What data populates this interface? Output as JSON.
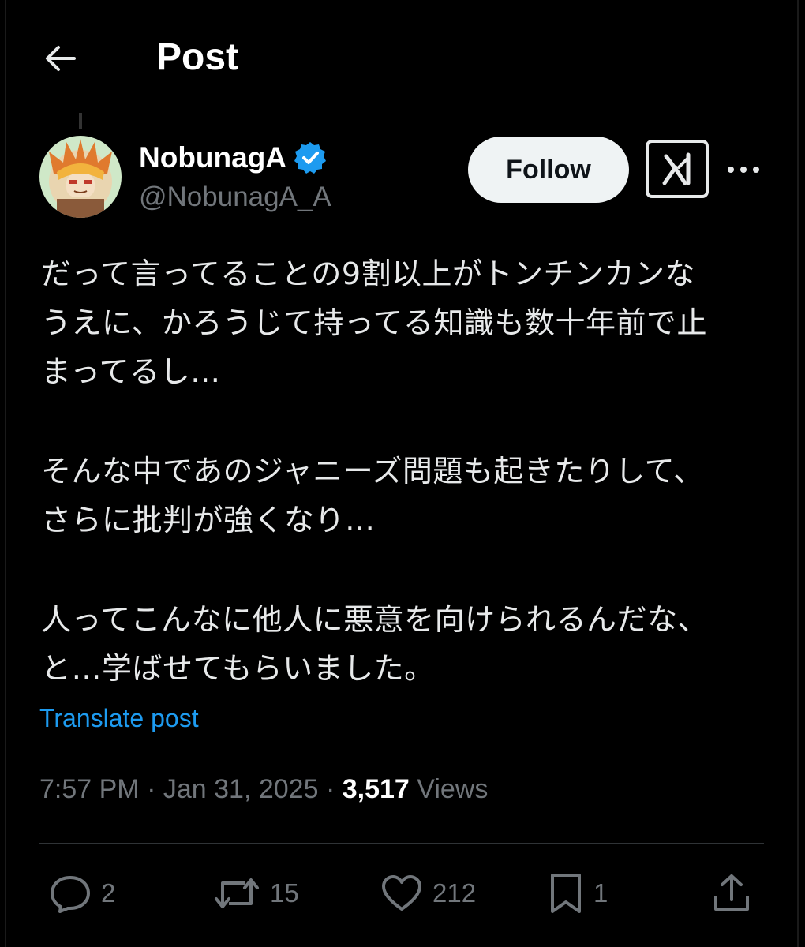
{
  "header": {
    "title": "Post"
  },
  "author": {
    "display_name": "NobunagA",
    "handle": "@NobunagA_A",
    "verified": true
  },
  "buttons": {
    "follow_label": "Follow"
  },
  "post": {
    "paragraphs": [
      [
        "だって言ってることの9割以上がトンチンカンな",
        "うえに、かろうじて持ってる知識も数十年前で止",
        "まってるし…"
      ],
      [
        "そんな中であのジャニーズ問題も起きたりして、",
        "さらに批判が強くなり…"
      ],
      [
        "人ってこんなに他人に悪意を向けられるんだな、",
        "と…学ばせてもらいました。"
      ]
    ],
    "translate_label": "Translate post",
    "time": "7:57 PM",
    "date": "Jan 31, 2025",
    "views_count": "3,517",
    "views_label": "Views"
  },
  "actions": {
    "replies": "2",
    "reposts": "15",
    "likes": "212",
    "bookmarks": "1"
  },
  "colors": {
    "background": "#000000",
    "accent": "#1d9bf0",
    "secondary_text": "#71767b",
    "primary_text": "#e7e9ea"
  }
}
